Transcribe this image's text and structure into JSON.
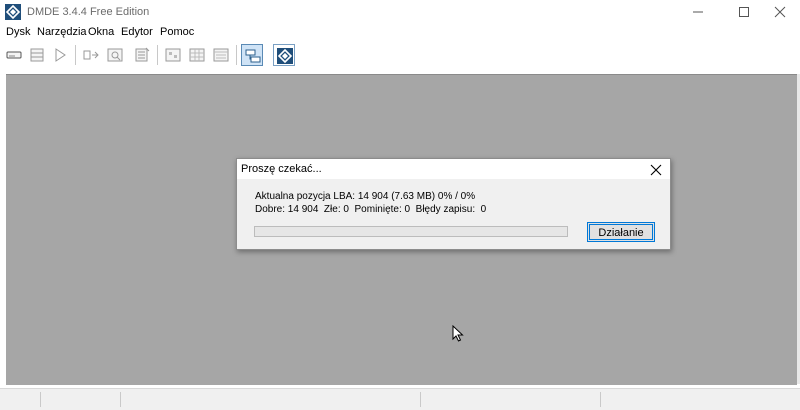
{
  "window": {
    "title": "DMDE 3.4.4 Free Edition",
    "icon": "dmde-app-icon",
    "controls": [
      "minimize-icon",
      "maximize-icon",
      "close-icon"
    ]
  },
  "menu": {
    "items": [
      {
        "label": "Dysk"
      },
      {
        "label": "Narzędzia"
      },
      {
        "label": "Okna"
      },
      {
        "label": "Edytor"
      },
      {
        "label": "Pomoc"
      }
    ]
  },
  "toolbar": {
    "buttons": [
      "drive-icon",
      "partitions-icon",
      "play-icon",
      "open-volume-icon",
      "search-icon",
      "editor-icon",
      "cluster-map-icon",
      "table-icon",
      "list-icon",
      "panel-icon",
      "dmde-logo-icon"
    ]
  },
  "dialog": {
    "title": "Proszę czekać...",
    "line1": "Aktualna pozycja LBA: 14 904 (7.63 MB) 0% / 0%",
    "line2": "Dobre: 14 904  Złe: 0  Pominięte: 0  Błędy zapisu:  0",
    "progress": 0,
    "action_label": "Działanie"
  },
  "colors": {
    "workspace": "#a6a6a6",
    "accent": "#0078d7",
    "progress_fill": "#06b025"
  }
}
